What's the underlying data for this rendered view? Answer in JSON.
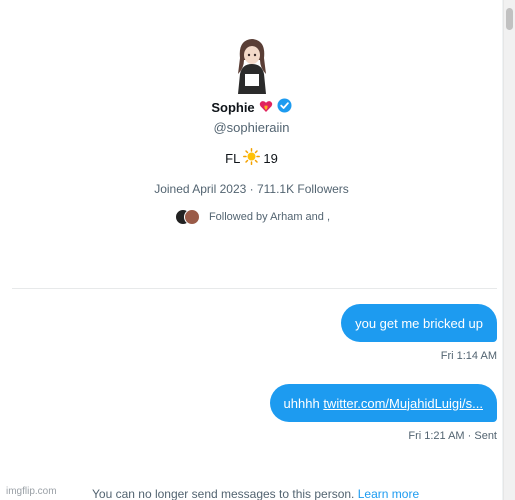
{
  "profile": {
    "name": "Sophie",
    "handle": "@sophieraiin",
    "bio_prefix": "FL",
    "bio_suffix": "19",
    "meta": "Joined April 2023 · 711.1K Followers",
    "followed_by": "Followed by Arham and ,"
  },
  "messages": [
    {
      "text": "you get me bricked up",
      "timestamp": "Fri 1:14 AM"
    },
    {
      "text_prefix": "uhhhh ",
      "link": "twitter.com/MujahidLuigi/s...",
      "timestamp": "Fri 1:21 AM · Sent"
    }
  ],
  "footer": {
    "notice": "You can no longer send messages to this person.",
    "learn_more": "Learn more",
    "watermark": "imgflip.com"
  },
  "colors": {
    "accent": "#1d9bf0",
    "muted": "#536471",
    "text": "#0f1419"
  },
  "icons": [
    "verified-badge-icon",
    "heart-fire-emoji-icon",
    "sun-emoji-icon"
  ]
}
